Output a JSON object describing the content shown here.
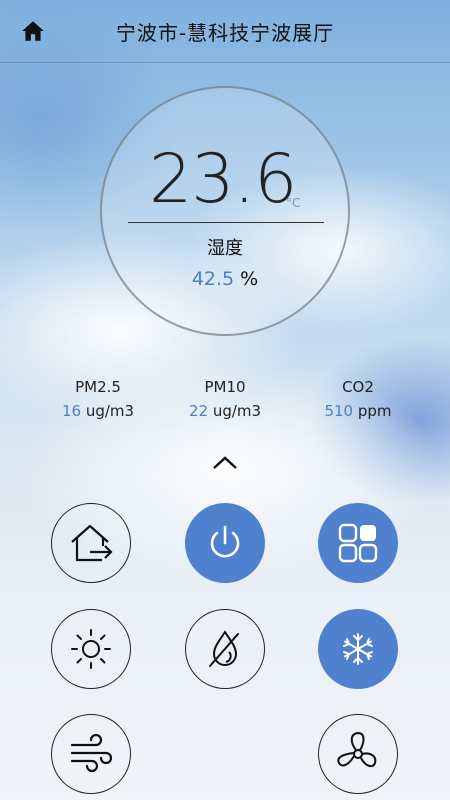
{
  "header": {
    "title": "宁波市-慧科技宁波展厅",
    "home_icon": "home-icon"
  },
  "climate": {
    "temperature": "23.6",
    "temperature_unit": "°C",
    "humidity_label": "湿度",
    "humidity_value": "42.5",
    "humidity_unit": "%"
  },
  "metrics": [
    {
      "label": "PM2.5",
      "value": "16",
      "unit": "ug/m3"
    },
    {
      "label": "PM10",
      "value": "22",
      "unit": "ug/m3"
    },
    {
      "label": "CO2",
      "value": "510",
      "unit": "ppm"
    }
  ],
  "colors": {
    "accent": "#4f81cf",
    "value_text": "#4a7fc9"
  },
  "controls": [
    {
      "icon": "home-exit-icon",
      "active": false
    },
    {
      "icon": "power-icon",
      "active": true
    },
    {
      "icon": "apps-grid-icon",
      "active": true
    },
    {
      "icon": "sun-icon",
      "active": false
    },
    {
      "icon": "no-drop-icon",
      "active": false
    },
    {
      "icon": "snowflake-icon",
      "active": true
    },
    {
      "icon": "wind-icon",
      "active": false
    },
    {
      "icon": "fan-icon",
      "active": false
    }
  ]
}
